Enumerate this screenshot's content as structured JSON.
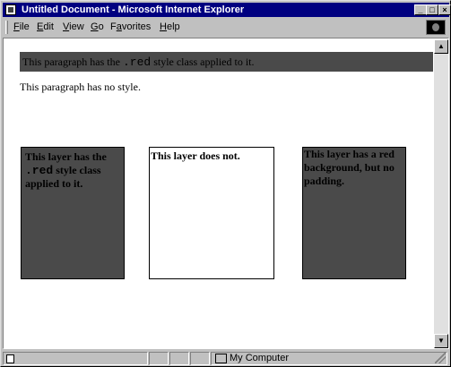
{
  "window": {
    "title": "Untitled Document - Microsoft Internet Explorer",
    "controls": {
      "minimize": "_",
      "maximize": "□",
      "close": "×"
    }
  },
  "menubar": {
    "items": [
      {
        "accel": "F",
        "rest": "ile"
      },
      {
        "accel": "E",
        "rest": "dit"
      },
      {
        "accel": "V",
        "rest": "iew"
      },
      {
        "accel": "G",
        "rest": "o"
      },
      {
        "accel": "a",
        "pre": "F",
        "rest": "vorites"
      },
      {
        "accel": "H",
        "rest": "elp"
      }
    ]
  },
  "page": {
    "p_red_before": "This paragraph has the ",
    "p_red_code": ".red",
    "p_red_after": " style class applied to it.",
    "p_plain": "This paragraph has no style.",
    "layer1_before": "This layer has the ",
    "layer1_code": ".red",
    "layer1_after": " style class applied to it.",
    "layer2": "This layer does not.",
    "layer3": "This layer has a red background, but no padding."
  },
  "statusbar": {
    "zone": "My Computer"
  },
  "colors": {
    "titlebar": "#000080",
    "red_rendered_gray": "#4a4a4a"
  },
  "icons": {
    "title": "ie-page-icon",
    "throbber": "windows-logo-icon",
    "status": "page-icon",
    "zone": "computer-icon"
  }
}
